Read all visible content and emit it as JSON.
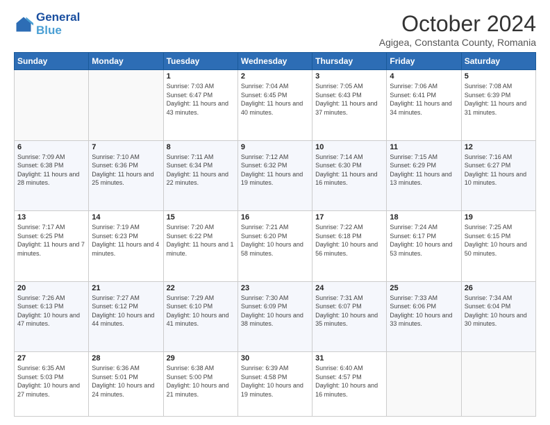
{
  "logo": {
    "line1": "General",
    "line2": "Blue"
  },
  "title": "October 2024",
  "subtitle": "Agigea, Constanta County, Romania",
  "headers": [
    "Sunday",
    "Monday",
    "Tuesday",
    "Wednesday",
    "Thursday",
    "Friday",
    "Saturday"
  ],
  "weeks": [
    [
      {
        "day": "",
        "info": ""
      },
      {
        "day": "",
        "info": ""
      },
      {
        "day": "1",
        "info": "Sunrise: 7:03 AM\nSunset: 6:47 PM\nDaylight: 11 hours and 43 minutes."
      },
      {
        "day": "2",
        "info": "Sunrise: 7:04 AM\nSunset: 6:45 PM\nDaylight: 11 hours and 40 minutes."
      },
      {
        "day": "3",
        "info": "Sunrise: 7:05 AM\nSunset: 6:43 PM\nDaylight: 11 hours and 37 minutes."
      },
      {
        "day": "4",
        "info": "Sunrise: 7:06 AM\nSunset: 6:41 PM\nDaylight: 11 hours and 34 minutes."
      },
      {
        "day": "5",
        "info": "Sunrise: 7:08 AM\nSunset: 6:39 PM\nDaylight: 11 hours and 31 minutes."
      }
    ],
    [
      {
        "day": "6",
        "info": "Sunrise: 7:09 AM\nSunset: 6:38 PM\nDaylight: 11 hours and 28 minutes."
      },
      {
        "day": "7",
        "info": "Sunrise: 7:10 AM\nSunset: 6:36 PM\nDaylight: 11 hours and 25 minutes."
      },
      {
        "day": "8",
        "info": "Sunrise: 7:11 AM\nSunset: 6:34 PM\nDaylight: 11 hours and 22 minutes."
      },
      {
        "day": "9",
        "info": "Sunrise: 7:12 AM\nSunset: 6:32 PM\nDaylight: 11 hours and 19 minutes."
      },
      {
        "day": "10",
        "info": "Sunrise: 7:14 AM\nSunset: 6:30 PM\nDaylight: 11 hours and 16 minutes."
      },
      {
        "day": "11",
        "info": "Sunrise: 7:15 AM\nSunset: 6:29 PM\nDaylight: 11 hours and 13 minutes."
      },
      {
        "day": "12",
        "info": "Sunrise: 7:16 AM\nSunset: 6:27 PM\nDaylight: 11 hours and 10 minutes."
      }
    ],
    [
      {
        "day": "13",
        "info": "Sunrise: 7:17 AM\nSunset: 6:25 PM\nDaylight: 11 hours and 7 minutes."
      },
      {
        "day": "14",
        "info": "Sunrise: 7:19 AM\nSunset: 6:23 PM\nDaylight: 11 hours and 4 minutes."
      },
      {
        "day": "15",
        "info": "Sunrise: 7:20 AM\nSunset: 6:22 PM\nDaylight: 11 hours and 1 minute."
      },
      {
        "day": "16",
        "info": "Sunrise: 7:21 AM\nSunset: 6:20 PM\nDaylight: 10 hours and 58 minutes."
      },
      {
        "day": "17",
        "info": "Sunrise: 7:22 AM\nSunset: 6:18 PM\nDaylight: 10 hours and 56 minutes."
      },
      {
        "day": "18",
        "info": "Sunrise: 7:24 AM\nSunset: 6:17 PM\nDaylight: 10 hours and 53 minutes."
      },
      {
        "day": "19",
        "info": "Sunrise: 7:25 AM\nSunset: 6:15 PM\nDaylight: 10 hours and 50 minutes."
      }
    ],
    [
      {
        "day": "20",
        "info": "Sunrise: 7:26 AM\nSunset: 6:13 PM\nDaylight: 10 hours and 47 minutes."
      },
      {
        "day": "21",
        "info": "Sunrise: 7:27 AM\nSunset: 6:12 PM\nDaylight: 10 hours and 44 minutes."
      },
      {
        "day": "22",
        "info": "Sunrise: 7:29 AM\nSunset: 6:10 PM\nDaylight: 10 hours and 41 minutes."
      },
      {
        "day": "23",
        "info": "Sunrise: 7:30 AM\nSunset: 6:09 PM\nDaylight: 10 hours and 38 minutes."
      },
      {
        "day": "24",
        "info": "Sunrise: 7:31 AM\nSunset: 6:07 PM\nDaylight: 10 hours and 35 minutes."
      },
      {
        "day": "25",
        "info": "Sunrise: 7:33 AM\nSunset: 6:06 PM\nDaylight: 10 hours and 33 minutes."
      },
      {
        "day": "26",
        "info": "Sunrise: 7:34 AM\nSunset: 6:04 PM\nDaylight: 10 hours and 30 minutes."
      }
    ],
    [
      {
        "day": "27",
        "info": "Sunrise: 6:35 AM\nSunset: 5:03 PM\nDaylight: 10 hours and 27 minutes."
      },
      {
        "day": "28",
        "info": "Sunrise: 6:36 AM\nSunset: 5:01 PM\nDaylight: 10 hours and 24 minutes."
      },
      {
        "day": "29",
        "info": "Sunrise: 6:38 AM\nSunset: 5:00 PM\nDaylight: 10 hours and 21 minutes."
      },
      {
        "day": "30",
        "info": "Sunrise: 6:39 AM\nSunset: 4:58 PM\nDaylight: 10 hours and 19 minutes."
      },
      {
        "day": "31",
        "info": "Sunrise: 6:40 AM\nSunset: 4:57 PM\nDaylight: 10 hours and 16 minutes."
      },
      {
        "day": "",
        "info": ""
      },
      {
        "day": "",
        "info": ""
      }
    ]
  ]
}
